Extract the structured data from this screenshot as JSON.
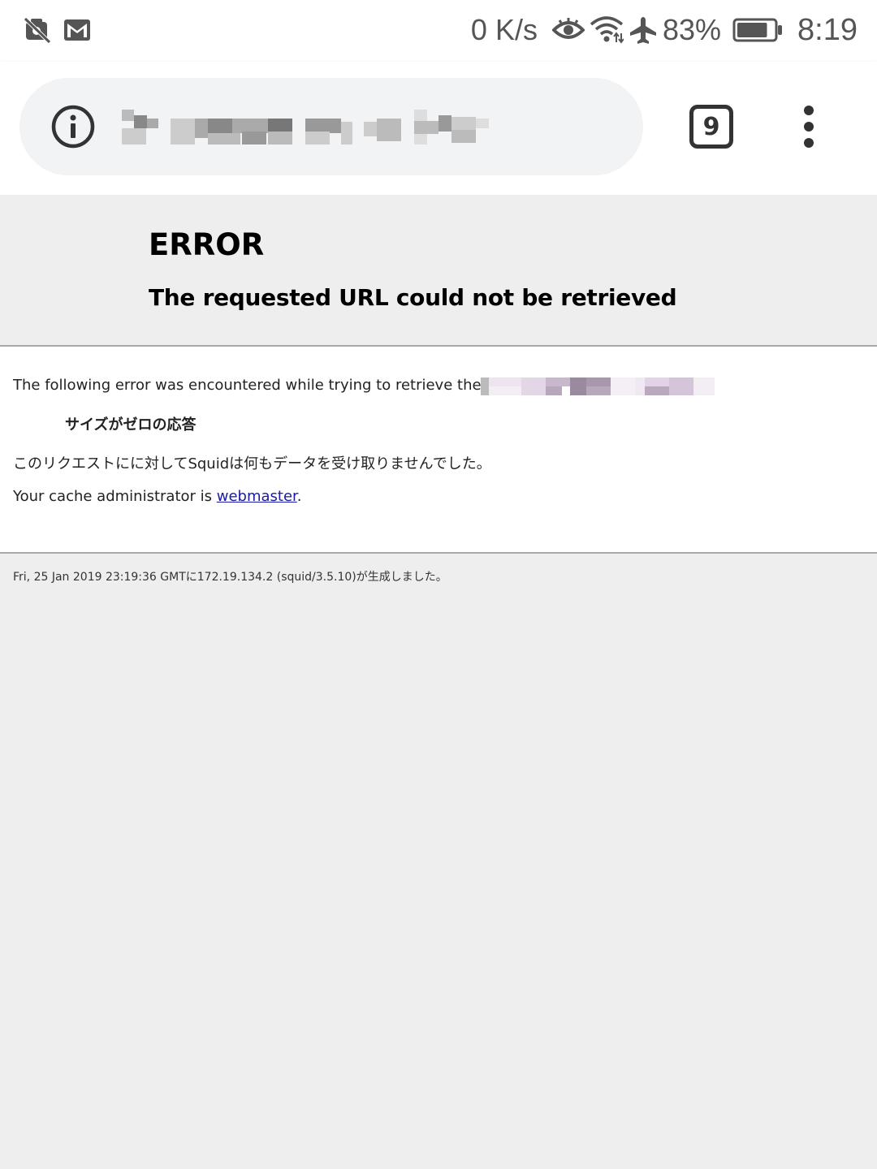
{
  "status_bar": {
    "left_icons": [
      "unknown-app-off-icon",
      "gmail-icon"
    ],
    "network_speed": "0 K/s",
    "status_icons": [
      "eye-comfort-icon",
      "wifi-icon",
      "airplane-mode-icon"
    ],
    "battery_percent": "83%",
    "battery_level": 0.83,
    "time": "8:19"
  },
  "browser": {
    "page_info_icon": "info-icon",
    "tab_count": "9",
    "menu_icon": "overflow-menu-icon",
    "omnibox_color": "#f1f3f4"
  },
  "page": {
    "title": "ERROR",
    "subtitle": "The requested URL could not be retrieved",
    "intro": "The following error was encountered while trying to retrieve the URL:",
    "reason": "サイズがゼロの応答",
    "description": "このリクエストにに対してSquidは何もデータを受け取りませんでした。",
    "admin_prefix": "Your cache administrator is ",
    "admin_link": "webmaster",
    "admin_suffix": ".",
    "footer": "Fri, 25 Jan 2019 23:19:36 GMTに172.19.134.2 (squid/3.5.10)が生成しました。",
    "link_color": "#1a1aa6"
  }
}
